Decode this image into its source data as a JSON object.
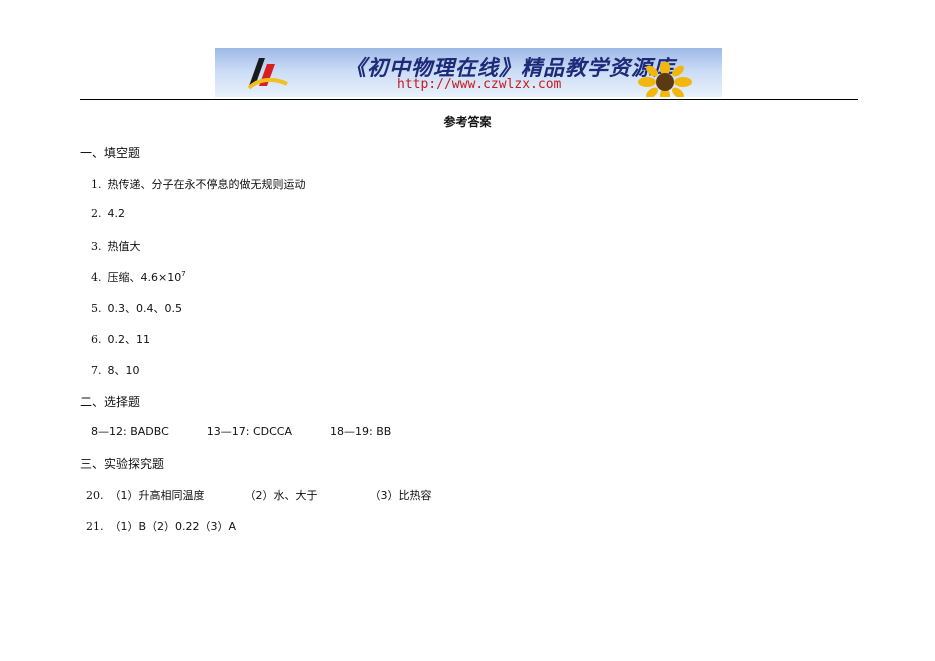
{
  "banner": {
    "title": "《初中物理在线》精品教学资源库",
    "url": "http://www.czwlzx.com"
  },
  "doc_title": "参考答案",
  "sections": [
    {
      "heading": "一、填空题",
      "items": [
        {
          "num": "1.",
          "text": "热传递、分子在永不停息的做无规则运动"
        },
        {
          "num": "2.",
          "text": "4.2"
        },
        {
          "num": "3.",
          "text": "热值大"
        },
        {
          "num": "4.",
          "text": "压缩、4.6×10",
          "sup": "7"
        },
        {
          "num": "5.",
          "text": "0.3、0.4、0.5"
        },
        {
          "num": "6.",
          "text": "0.2、11"
        },
        {
          "num": "7.",
          "text": "8、10"
        }
      ]
    },
    {
      "heading": "二、选择题",
      "choice_answers": [
        "8—12: BADBC",
        "13—17: CDCCA",
        "18—19: BB"
      ]
    },
    {
      "heading": "三、实验探究题",
      "q20": {
        "num": "20.",
        "parts": [
          "（1）升高相同温度",
          "（2）水、大于",
          "（3）比热容"
        ]
      },
      "q21": {
        "num": "21.",
        "text": "（1）B（2）0.22（3）A"
      }
    }
  ]
}
